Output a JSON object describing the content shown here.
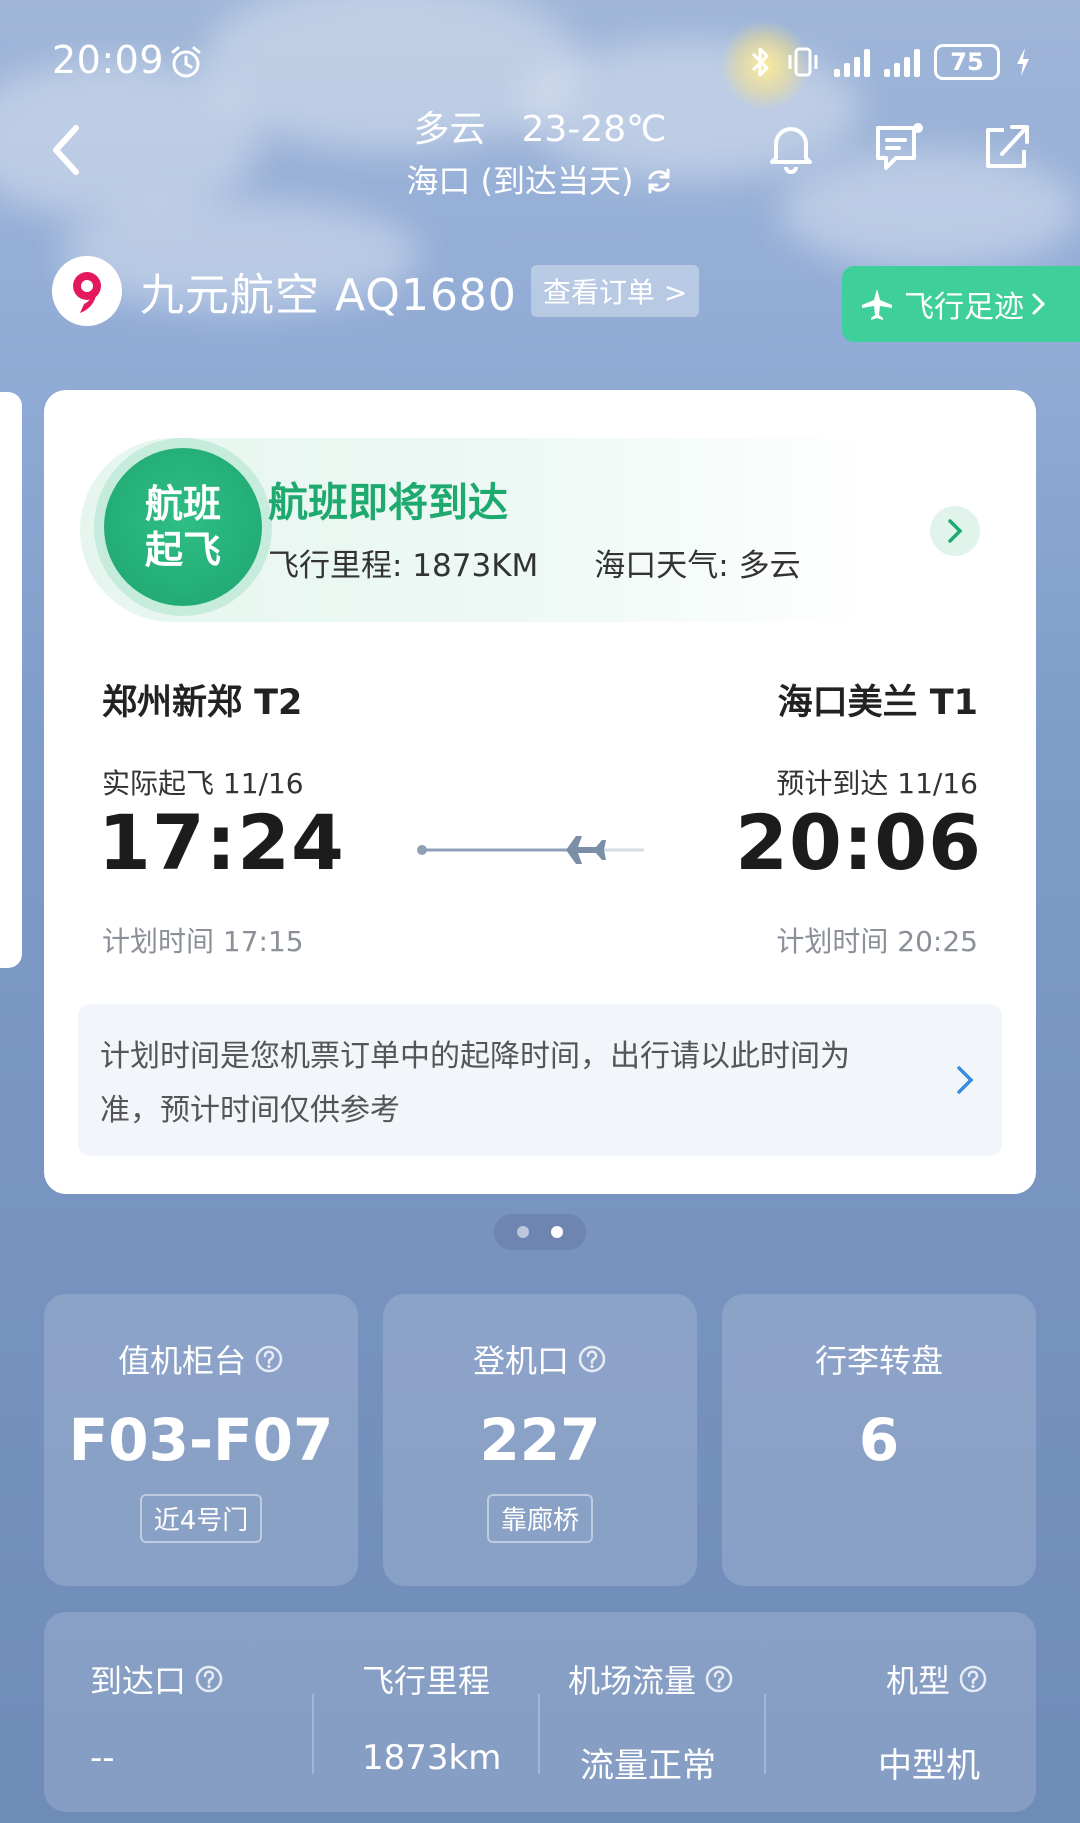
{
  "status_bar": {
    "time": "20:09",
    "battery": "75",
    "icons": [
      "alarm-icon",
      "bluetooth-icon",
      "vibrate-icon",
      "signal-icon",
      "signal-icon",
      "battery-icon",
      "charging-icon"
    ]
  },
  "header": {
    "weather_condition": "多云",
    "temperature": "23-28℃",
    "location_note": "海口 (到达当天)"
  },
  "airline": {
    "name_flight": "九元航空 AQ1680",
    "order_button": "查看订单 >",
    "track_button": "飞行足迹"
  },
  "flight_card": {
    "badge_line1": "航班",
    "badge_line2": "起飞",
    "status_title": "航班即将到达",
    "distance_text": "飞行里程: 1873KM",
    "weather_text": "海口天气: 多云",
    "departure": {
      "airport": "郑州新郑 T2",
      "label": "实际起飞 11/16",
      "time": "17:24",
      "scheduled": "计划时间 17:15"
    },
    "arrival": {
      "airport": "海口美兰 T1",
      "label": "预计到达 11/16",
      "time": "20:06",
      "scheduled": "计划时间 20:25"
    },
    "note": "计划时间是您机票订单中的起降时间，出行请以此时间为准，预计时间仅供参考"
  },
  "tiles": [
    {
      "title": "值机柜台",
      "value": "F03-F07",
      "tag": "近4号门"
    },
    {
      "title": "登机口",
      "value": "227",
      "tag": "靠廊桥"
    },
    {
      "title": "行李转盘",
      "value": "6",
      "tag": ""
    }
  ],
  "bottom_info": [
    {
      "title": "到达口",
      "value": "--"
    },
    {
      "title": "飞行里程",
      "value": "1873km"
    },
    {
      "title": "机场流量",
      "value": "流量正常"
    },
    {
      "title": "机型",
      "value": "中型机"
    }
  ],
  "colors": {
    "accent_green": "#1eaa6e",
    "track_button_bg": "#3fcf9b",
    "background_top": "#9fb6d8",
    "background_bottom": "#6f8bb8"
  }
}
